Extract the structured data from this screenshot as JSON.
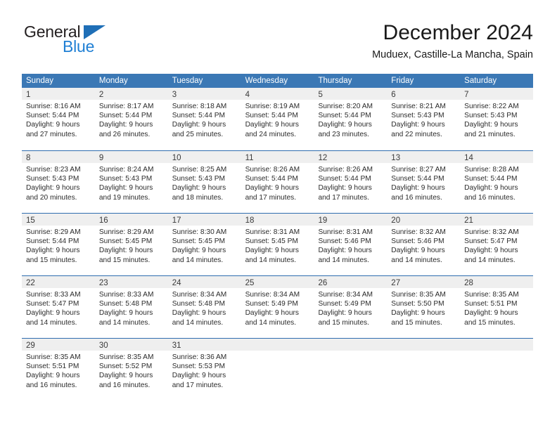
{
  "logo": {
    "word_primary": "General",
    "word_secondary": "Blue",
    "triangle_color": "#1f6fb7",
    "secondary_color": "#1f7fd4"
  },
  "header": {
    "title": "December 2024",
    "subtitle": "Muduex, Castille-La Mancha, Spain"
  },
  "theme": {
    "header_blue": "#3b78b5",
    "week_divider_blue": "#2f6daf",
    "day_band_gray": "#efefef"
  },
  "weekdays": [
    "Sunday",
    "Monday",
    "Tuesday",
    "Wednesday",
    "Thursday",
    "Friday",
    "Saturday"
  ],
  "weeks": [
    [
      {
        "day": "1",
        "sunrise": "Sunrise: 8:16 AM",
        "sunset": "Sunset: 5:44 PM",
        "daylight1": "Daylight: 9 hours",
        "daylight2": "and 27 minutes."
      },
      {
        "day": "2",
        "sunrise": "Sunrise: 8:17 AM",
        "sunset": "Sunset: 5:44 PM",
        "daylight1": "Daylight: 9 hours",
        "daylight2": "and 26 minutes."
      },
      {
        "day": "3",
        "sunrise": "Sunrise: 8:18 AM",
        "sunset": "Sunset: 5:44 PM",
        "daylight1": "Daylight: 9 hours",
        "daylight2": "and 25 minutes."
      },
      {
        "day": "4",
        "sunrise": "Sunrise: 8:19 AM",
        "sunset": "Sunset: 5:44 PM",
        "daylight1": "Daylight: 9 hours",
        "daylight2": "and 24 minutes."
      },
      {
        "day": "5",
        "sunrise": "Sunrise: 8:20 AM",
        "sunset": "Sunset: 5:44 PM",
        "daylight1": "Daylight: 9 hours",
        "daylight2": "and 23 minutes."
      },
      {
        "day": "6",
        "sunrise": "Sunrise: 8:21 AM",
        "sunset": "Sunset: 5:43 PM",
        "daylight1": "Daylight: 9 hours",
        "daylight2": "and 22 minutes."
      },
      {
        "day": "7",
        "sunrise": "Sunrise: 8:22 AM",
        "sunset": "Sunset: 5:43 PM",
        "daylight1": "Daylight: 9 hours",
        "daylight2": "and 21 minutes."
      }
    ],
    [
      {
        "day": "8",
        "sunrise": "Sunrise: 8:23 AM",
        "sunset": "Sunset: 5:43 PM",
        "daylight1": "Daylight: 9 hours",
        "daylight2": "and 20 minutes."
      },
      {
        "day": "9",
        "sunrise": "Sunrise: 8:24 AM",
        "sunset": "Sunset: 5:43 PM",
        "daylight1": "Daylight: 9 hours",
        "daylight2": "and 19 minutes."
      },
      {
        "day": "10",
        "sunrise": "Sunrise: 8:25 AM",
        "sunset": "Sunset: 5:43 PM",
        "daylight1": "Daylight: 9 hours",
        "daylight2": "and 18 minutes."
      },
      {
        "day": "11",
        "sunrise": "Sunrise: 8:26 AM",
        "sunset": "Sunset: 5:44 PM",
        "daylight1": "Daylight: 9 hours",
        "daylight2": "and 17 minutes."
      },
      {
        "day": "12",
        "sunrise": "Sunrise: 8:26 AM",
        "sunset": "Sunset: 5:44 PM",
        "daylight1": "Daylight: 9 hours",
        "daylight2": "and 17 minutes."
      },
      {
        "day": "13",
        "sunrise": "Sunrise: 8:27 AM",
        "sunset": "Sunset: 5:44 PM",
        "daylight1": "Daylight: 9 hours",
        "daylight2": "and 16 minutes."
      },
      {
        "day": "14",
        "sunrise": "Sunrise: 8:28 AM",
        "sunset": "Sunset: 5:44 PM",
        "daylight1": "Daylight: 9 hours",
        "daylight2": "and 16 minutes."
      }
    ],
    [
      {
        "day": "15",
        "sunrise": "Sunrise: 8:29 AM",
        "sunset": "Sunset: 5:44 PM",
        "daylight1": "Daylight: 9 hours",
        "daylight2": "and 15 minutes."
      },
      {
        "day": "16",
        "sunrise": "Sunrise: 8:29 AM",
        "sunset": "Sunset: 5:45 PM",
        "daylight1": "Daylight: 9 hours",
        "daylight2": "and 15 minutes."
      },
      {
        "day": "17",
        "sunrise": "Sunrise: 8:30 AM",
        "sunset": "Sunset: 5:45 PM",
        "daylight1": "Daylight: 9 hours",
        "daylight2": "and 14 minutes."
      },
      {
        "day": "18",
        "sunrise": "Sunrise: 8:31 AM",
        "sunset": "Sunset: 5:45 PM",
        "daylight1": "Daylight: 9 hours",
        "daylight2": "and 14 minutes."
      },
      {
        "day": "19",
        "sunrise": "Sunrise: 8:31 AM",
        "sunset": "Sunset: 5:46 PM",
        "daylight1": "Daylight: 9 hours",
        "daylight2": "and 14 minutes."
      },
      {
        "day": "20",
        "sunrise": "Sunrise: 8:32 AM",
        "sunset": "Sunset: 5:46 PM",
        "daylight1": "Daylight: 9 hours",
        "daylight2": "and 14 minutes."
      },
      {
        "day": "21",
        "sunrise": "Sunrise: 8:32 AM",
        "sunset": "Sunset: 5:47 PM",
        "daylight1": "Daylight: 9 hours",
        "daylight2": "and 14 minutes."
      }
    ],
    [
      {
        "day": "22",
        "sunrise": "Sunrise: 8:33 AM",
        "sunset": "Sunset: 5:47 PM",
        "daylight1": "Daylight: 9 hours",
        "daylight2": "and 14 minutes."
      },
      {
        "day": "23",
        "sunrise": "Sunrise: 8:33 AM",
        "sunset": "Sunset: 5:48 PM",
        "daylight1": "Daylight: 9 hours",
        "daylight2": "and 14 minutes."
      },
      {
        "day": "24",
        "sunrise": "Sunrise: 8:34 AM",
        "sunset": "Sunset: 5:48 PM",
        "daylight1": "Daylight: 9 hours",
        "daylight2": "and 14 minutes."
      },
      {
        "day": "25",
        "sunrise": "Sunrise: 8:34 AM",
        "sunset": "Sunset: 5:49 PM",
        "daylight1": "Daylight: 9 hours",
        "daylight2": "and 14 minutes."
      },
      {
        "day": "26",
        "sunrise": "Sunrise: 8:34 AM",
        "sunset": "Sunset: 5:49 PM",
        "daylight1": "Daylight: 9 hours",
        "daylight2": "and 15 minutes."
      },
      {
        "day": "27",
        "sunrise": "Sunrise: 8:35 AM",
        "sunset": "Sunset: 5:50 PM",
        "daylight1": "Daylight: 9 hours",
        "daylight2": "and 15 minutes."
      },
      {
        "day": "28",
        "sunrise": "Sunrise: 8:35 AM",
        "sunset": "Sunset: 5:51 PM",
        "daylight1": "Daylight: 9 hours",
        "daylight2": "and 15 minutes."
      }
    ],
    [
      {
        "day": "29",
        "sunrise": "Sunrise: 8:35 AM",
        "sunset": "Sunset: 5:51 PM",
        "daylight1": "Daylight: 9 hours",
        "daylight2": "and 16 minutes."
      },
      {
        "day": "30",
        "sunrise": "Sunrise: 8:35 AM",
        "sunset": "Sunset: 5:52 PM",
        "daylight1": "Daylight: 9 hours",
        "daylight2": "and 16 minutes."
      },
      {
        "day": "31",
        "sunrise": "Sunrise: 8:36 AM",
        "sunset": "Sunset: 5:53 PM",
        "daylight1": "Daylight: 9 hours",
        "daylight2": "and 17 minutes."
      },
      {
        "day": "",
        "sunrise": "",
        "sunset": "",
        "daylight1": "",
        "daylight2": ""
      },
      {
        "day": "",
        "sunrise": "",
        "sunset": "",
        "daylight1": "",
        "daylight2": ""
      },
      {
        "day": "",
        "sunrise": "",
        "sunset": "",
        "daylight1": "",
        "daylight2": ""
      },
      {
        "day": "",
        "sunrise": "",
        "sunset": "",
        "daylight1": "",
        "daylight2": ""
      }
    ]
  ]
}
